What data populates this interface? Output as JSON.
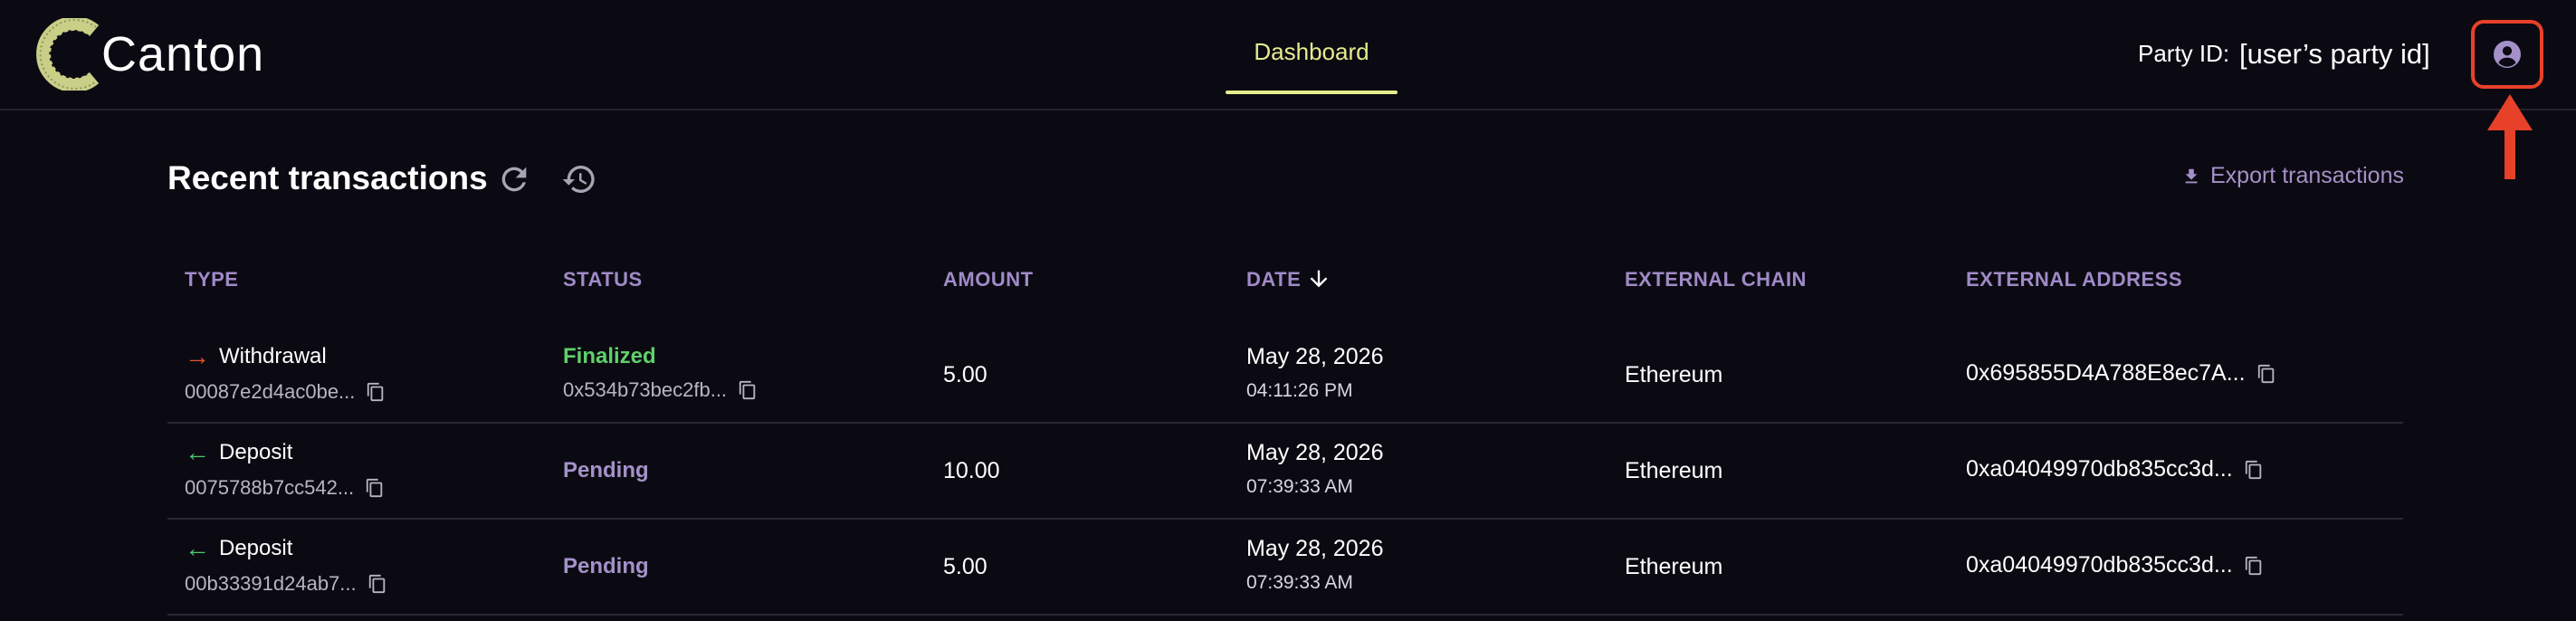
{
  "header": {
    "brand": "Canton",
    "nav_tab": "Dashboard",
    "party_label": "Party ID:",
    "party_value": "[user’s party id]",
    "profile_icon": "account-circle-icon"
  },
  "colors": {
    "accent": "#e6ec8e",
    "header_label": "#a08ac8",
    "finalized": "#5fd06a",
    "pending": "#a591c9",
    "withdrawal_arrow": "#e8542a",
    "deposit_arrow": "#4ec96a",
    "annotation": "#e8412a"
  },
  "section": {
    "title": "Recent transactions",
    "export_label": "Export transactions"
  },
  "table": {
    "columns": [
      "TYPE",
      "STATUS",
      "AMOUNT",
      "DATE",
      "EXTERNAL CHAIN",
      "EXTERNAL ADDRESS"
    ],
    "rows": [
      {
        "type": "Withdrawal",
        "arrow": "→",
        "id": "00087e2d4ac0be...",
        "status": "Finalized",
        "status_tx": "0x534b73bec2fb...",
        "amount": "5.00",
        "date": "May 28, 2026",
        "time": "04:11:26 PM",
        "chain": "Ethereum",
        "address": "0x695855D4A788E8ec7A..."
      },
      {
        "type": "Deposit",
        "arrow": "←",
        "id": "0075788b7cc542...",
        "status": "Pending",
        "status_tx": "",
        "amount": "10.00",
        "date": "May 28, 2026",
        "time": "07:39:33 AM",
        "chain": "Ethereum",
        "address": "0xa04049970db835cc3d..."
      },
      {
        "type": "Deposit",
        "arrow": "←",
        "id": "00b33391d24ab7...",
        "status": "Pending",
        "status_tx": "",
        "amount": "5.00",
        "date": "May 28, 2026",
        "time": "07:39:33 AM",
        "chain": "Ethereum",
        "address": "0xa04049970db835cc3d..."
      }
    ]
  }
}
